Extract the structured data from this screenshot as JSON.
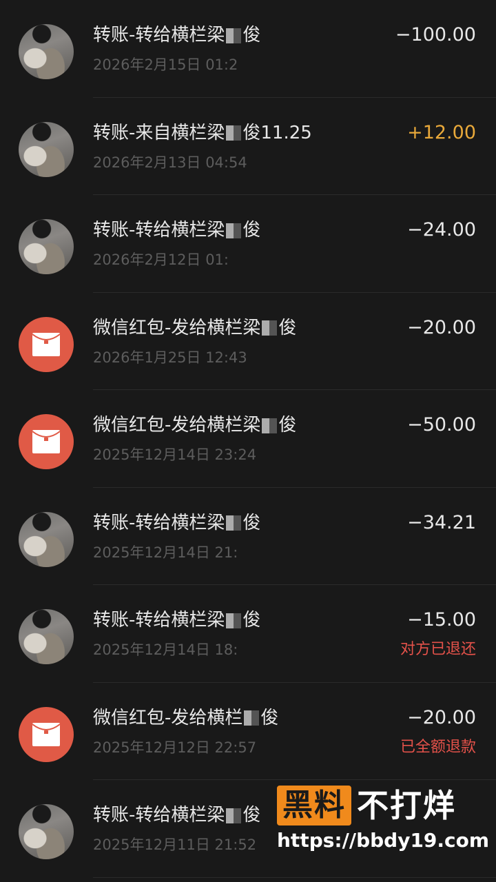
{
  "transactions": [
    {
      "type": "photo",
      "title": "转账-转给横栏梁",
      "title_end": "俊",
      "time": "2026年2月15日 01:2",
      "amount": "−100.00",
      "status": ""
    },
    {
      "type": "photo",
      "title": "转账-来自横栏梁",
      "title_end": "俊11.25",
      "time": "2026年2月13日 04:54",
      "amount": "+12.00",
      "status": ""
    },
    {
      "type": "photo",
      "title": "转账-转给横栏梁",
      "title_end": "俊",
      "time": "2026年2月12日 01:",
      "amount": "−24.00",
      "status": ""
    },
    {
      "type": "redpacket",
      "title": "微信红包-发给横栏梁",
      "title_end": "俊",
      "time": "2026年1月25日 12:43",
      "amount": "−20.00",
      "status": ""
    },
    {
      "type": "redpacket",
      "title": "微信红包-发给横栏梁",
      "title_end": "俊",
      "time": "2025年12月14日 23:24",
      "amount": "−50.00",
      "status": ""
    },
    {
      "type": "photo",
      "title": "转账-转给横栏梁",
      "title_end": "俊",
      "time": "2025年12月14日 21:",
      "amount": "−34.21",
      "status": ""
    },
    {
      "type": "photo",
      "title": "转账-转给横栏梁",
      "title_end": "俊",
      "time": "2025年12月14日 18:",
      "amount": "−15.00",
      "status": "对方已退还"
    },
    {
      "type": "redpacket",
      "title": "微信红包-发给横栏",
      "title_end": "俊",
      "time": "2025年12月12日 22:57",
      "amount": "−20.00",
      "status": "已全额退款"
    },
    {
      "type": "photo",
      "title": "转账-转给横栏梁",
      "title_end": "俊",
      "time": "2025年12月11日 21:52",
      "amount": "",
      "status": ""
    }
  ],
  "watermark": {
    "logo_box": "黑料",
    "logo_rest": "不打烊",
    "url": "https://bbdy19.com"
  },
  "colors": {
    "background": "#191919",
    "positive_amount": "#e9a93a",
    "status_red": "#e5524a",
    "redpacket": "#e05a46"
  }
}
